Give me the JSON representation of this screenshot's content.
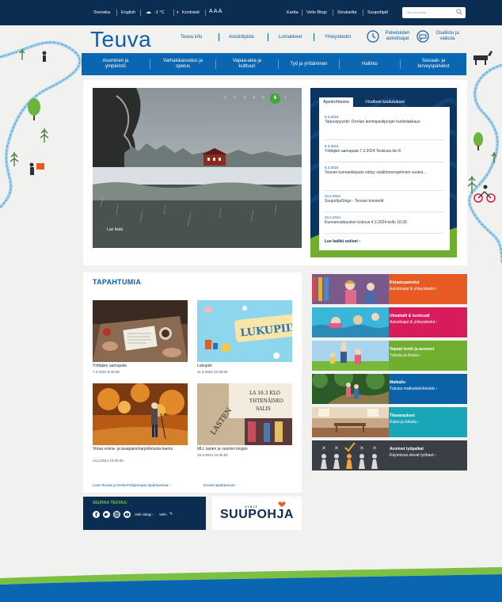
{
  "topbar": {
    "lang_sv": "Svenska",
    "lang_en": "English",
    "weather": "-1 °C",
    "contrast": "Kontrasti",
    "font_sizes": "A A A",
    "links": [
      "Kartta",
      "Velin Blogi",
      "Sivukartta",
      "Suupohjalt"
    ],
    "search_placeholder": "Hae sivustolta"
  },
  "header": {
    "logo": "Teuva",
    "nav": [
      "Teuva info",
      "Asiointipiste",
      "Lomakkeet",
      "Yhteystiedot"
    ],
    "services_label": "Palveluiden aukioloajat",
    "participate_label": "Osallistu ja vaikuta"
  },
  "main_nav": [
    "Asuminen ja ympäristö",
    "Varhaiskasvatus ja opetus",
    "Vapaa-aika ja kulttuuri",
    "Työ ja yrittäminen",
    "Hallinto",
    "Sosiaali- ja terveyspalvelut"
  ],
  "hero": {
    "read_more": "Lue lisää",
    "slides": [
      "1",
      "2",
      "3",
      "4",
      "5",
      "6",
      "7"
    ],
    "active_slide": "6"
  },
  "news": {
    "tab_current": "Ajankohtaista",
    "tab_official": "Viralliset kuulutukset",
    "items": [
      {
        "date": "6.3.2024",
        "title": "Tarjouspyyntö: Orrelan lammipaviljongin huoltolakkaus"
      },
      {
        "date": "5.3.2024",
        "title": "Yrittäjien aamupala 7.3.2024 Teskissa klo 8"
      },
      {
        "date": "5.3.2024",
        "title": "Teuvan kunnankirjasto siirtyy sisältömoregelmien vuoksi..."
      },
      {
        "date": "23.2.2024",
        "title": "SuupohjaSings - Teuvan konsertit"
      },
      {
        "date": "23.2.2024",
        "title": "Kunnanvaltuuston kokous 4.3.2024 kello 18.30"
      }
    ],
    "all_link": "Lue kaikki uutiset ›"
  },
  "events": {
    "title": "TAPAHTUMIA",
    "items": [
      {
        "title": "Yrittäjien aamupala",
        "date": "7.3.2024 8.00.00"
      },
      {
        "title": "Lukupiiri",
        "date": "11.3.2024 10.00.00"
      },
      {
        "title": "Virtaa voima- ja tasapainoharjoittelusta-luento",
        "date": "14.3.2024 10.00.00"
      },
      {
        "title": "MLL lasten ja nuorten kirppis",
        "date": "16.3.2024 12.00.00"
      }
    ],
    "list_link": "Lista Teuvan ja Etelä-Pohjanmaan tapahtumista ›",
    "report_link": "Ilmoita tapahtumasi ›",
    "poster_words": [
      "LUKUPIIRI",
      "LASTEN",
      "LA 16.3 KLO",
      "YHTENÄISKO",
      "SALIS"
    ]
  },
  "tiles": [
    {
      "title": "Kirjastopalvelut",
      "sub": "Aukioloajat & yhteystiedot ›",
      "color": "#e85a24"
    },
    {
      "title": "Uimahalli & kuntosali",
      "sub": "Aukioloajat & yhteystiedot ›",
      "color": "#d81b5a"
    },
    {
      "title": "Vapaat tontit ja asunnot",
      "sub": "Tutustu ja ihastu ›",
      "color": "#6fae2e"
    },
    {
      "title": "Matkailu",
      "sub": "Tutustu matkailukohteisiin ›",
      "color": "#0c62a6"
    },
    {
      "title": "Tilavaraukset",
      "sub": "Katso ja tutustu ›",
      "color": "#18a6b8"
    },
    {
      "title": "Avoimet työpaikat",
      "sub": "Käynnissä olevat työhaut ›",
      "color": "#3a3f45"
    }
  ],
  "follow": {
    "title": "SEURAA TEUVAA:",
    "blog": "Velin Blogi ›",
    "velin": "Velin"
  },
  "visit": {
    "small": "VISIT",
    "big": "SUUPOHJA"
  }
}
